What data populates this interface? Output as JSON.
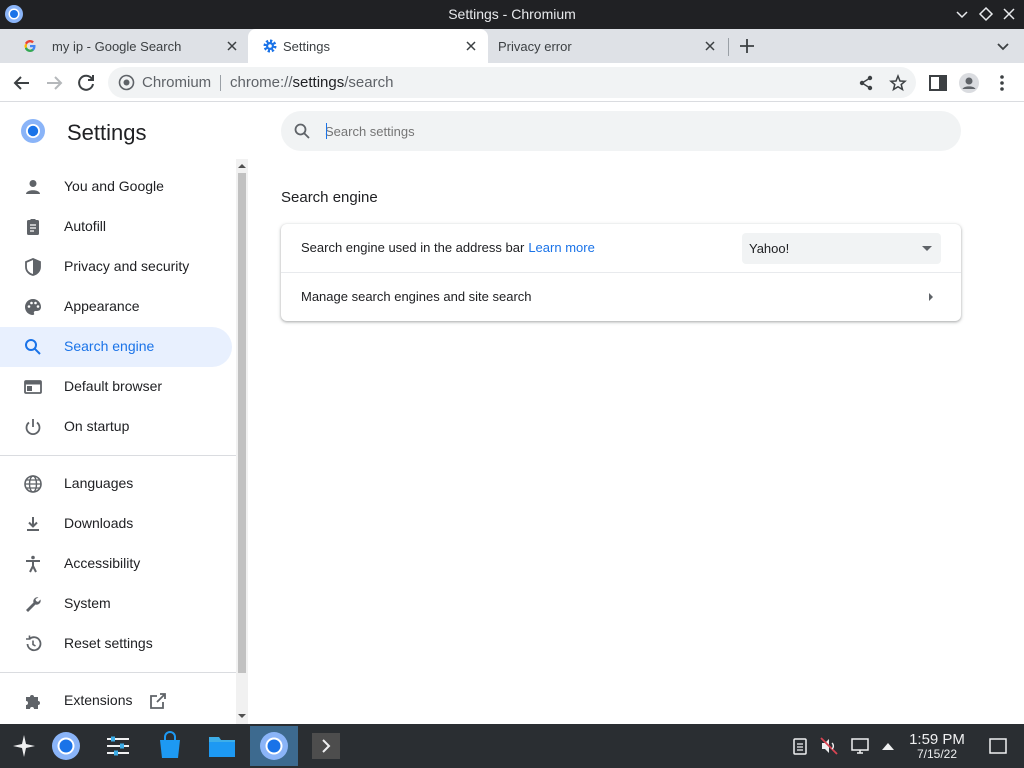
{
  "window": {
    "title": "Settings - Chromium"
  },
  "tabs": [
    {
      "title": "my ip - Google Search",
      "favicon": "google-g-icon",
      "active": false
    },
    {
      "title": "Settings",
      "favicon": "gear-icon",
      "active": true
    },
    {
      "title": "Privacy error",
      "favicon": "none",
      "active": false
    }
  ],
  "omnibox": {
    "chip": "Chromium",
    "url_scheme": "chrome://",
    "url_host": "settings",
    "url_path": "/search"
  },
  "settings": {
    "title": "Settings",
    "search_placeholder": "Search settings",
    "nav": [
      {
        "label": "You and Google",
        "icon": "person-icon"
      },
      {
        "label": "Autofill",
        "icon": "clipboard-icon"
      },
      {
        "label": "Privacy and security",
        "icon": "shield-icon"
      },
      {
        "label": "Appearance",
        "icon": "palette-icon"
      },
      {
        "label": "Search engine",
        "icon": "search-icon",
        "selected": true
      },
      {
        "label": "Default browser",
        "icon": "browser-window-icon"
      },
      {
        "label": "On startup",
        "icon": "power-icon"
      },
      {
        "label": "Languages",
        "icon": "globe-icon"
      },
      {
        "label": "Downloads",
        "icon": "download-icon"
      },
      {
        "label": "Accessibility",
        "icon": "accessibility-icon"
      },
      {
        "label": "System",
        "icon": "wrench-icon"
      },
      {
        "label": "Reset settings",
        "icon": "history-icon"
      },
      {
        "label": "Extensions",
        "icon": "puzzle-icon"
      }
    ],
    "section_title": "Search engine",
    "rows": {
      "engine_label": "Search engine used in the address bar",
      "learn_more": "Learn more",
      "engine_value": "Yahoo!",
      "manage_label": "Manage search engines and site search"
    }
  },
  "taskbar": {
    "time": "1:59 PM",
    "date": "7/15/22"
  },
  "colors": {
    "accent": "#1a73e8",
    "selected_nav_bg": "#e8f0fe",
    "titlebar": "#202124",
    "tabstrip": "#dee1e6",
    "taskbar": "#2a2e32"
  }
}
